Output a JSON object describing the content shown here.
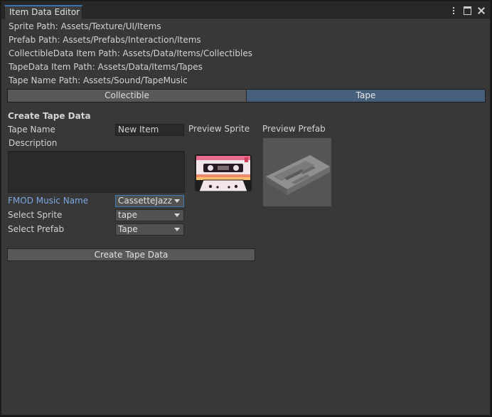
{
  "window": {
    "tab_title": "Item Data Editor",
    "icons": [
      "more-options-icon",
      "maximize-icon",
      "close-icon"
    ]
  },
  "paths": [
    "Sprite Path: Assets/Texture/UI/Items",
    "Prefab Path: Assets/Prefabs/Interaction/Items",
    "CollectibleData Item Path: Assets/Data/Items/Collectibles",
    "TapeData Item Path: Assets/Data/Items/Tapes",
    "Tape Name Path: Assets/Sound/TapeMusic"
  ],
  "toolbar": {
    "tabs": [
      {
        "label": "Collectible",
        "active": false
      },
      {
        "label": "Tape",
        "active": true
      }
    ]
  },
  "form": {
    "section_title": "Create Tape Data",
    "tape_name_label": "Tape Name",
    "tape_name_value": "New Item",
    "description_label": "Description",
    "description_value": "",
    "fmod_label": "FMOD Music Name",
    "fmod_value": "CassetteJazz",
    "sprite_label": "Select Sprite",
    "sprite_value": "tape",
    "prefab_label": "Select Prefab",
    "prefab_value": "Tape",
    "create_button": "Create Tape Data"
  },
  "preview": {
    "sprite_label": "Preview Sprite",
    "prefab_label": "Preview Prefab"
  },
  "colors": {
    "active_tab": "#46607c",
    "focus_label": "#7ba7e0",
    "tab_accent": "#3a72b0"
  }
}
